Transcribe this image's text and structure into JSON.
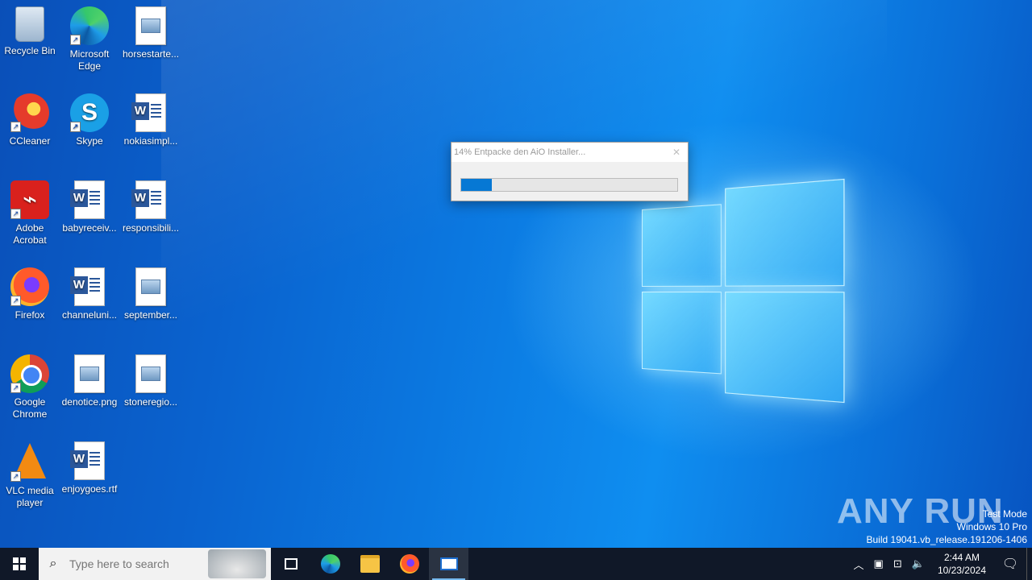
{
  "desktop": {
    "icons": [
      {
        "label": "Recycle Bin"
      },
      {
        "label": "Microsoft Edge"
      },
      {
        "label": "horsestarte..."
      },
      {
        "label": "CCleaner"
      },
      {
        "label": "Skype"
      },
      {
        "label": "nokiasimpl..."
      },
      {
        "label": "Adobe Acrobat"
      },
      {
        "label": "babyreceiv..."
      },
      {
        "label": "responsibili..."
      },
      {
        "label": "Firefox"
      },
      {
        "label": "channeluni..."
      },
      {
        "label": "september..."
      },
      {
        "label": "Google Chrome"
      },
      {
        "label": "denotice.png"
      },
      {
        "label": "stoneregio..."
      },
      {
        "label": "VLC media player"
      },
      {
        "label": "enjoygoes.rtf"
      }
    ]
  },
  "dialog": {
    "title": "14% Entpacke den AiO Installer...",
    "close_glyph": "✕",
    "progress_percent": 14
  },
  "watermark": {
    "brand": "ANY RUN",
    "line1": "Test Mode",
    "line2": "Windows 10 Pro",
    "line3": "Build 19041.vb_release.191206-1406"
  },
  "taskbar": {
    "search_placeholder": "Type here to search",
    "time": "2:44 AM",
    "date": "10/23/2024"
  }
}
